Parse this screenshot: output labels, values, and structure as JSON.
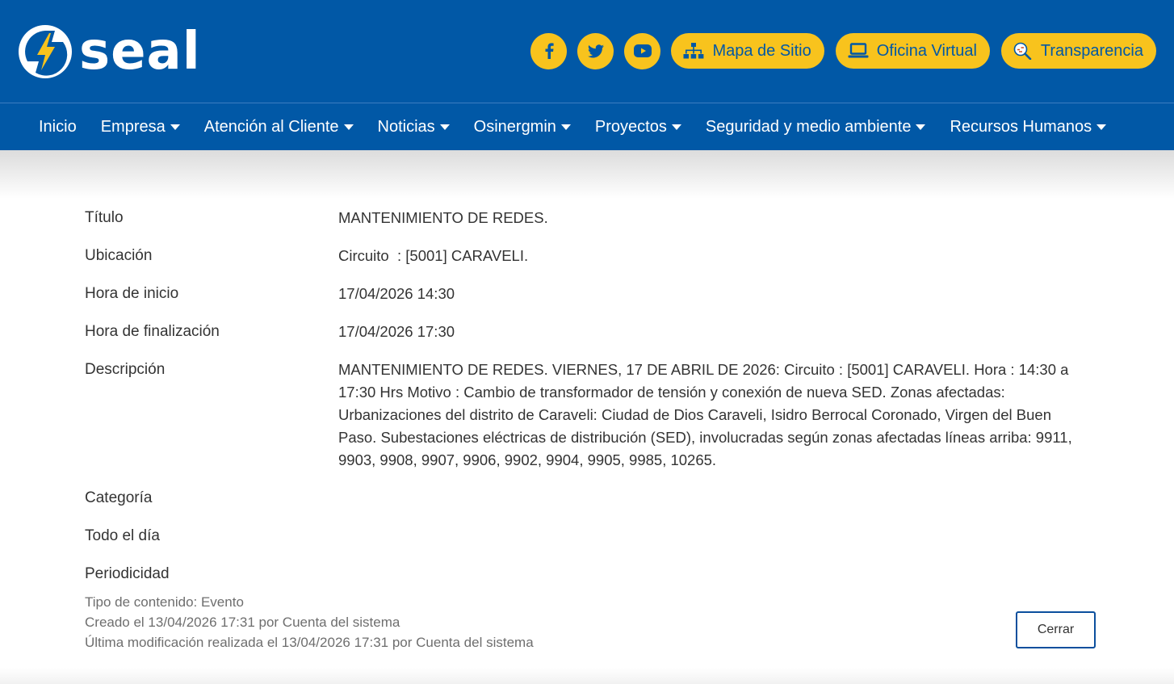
{
  "header": {
    "logo_text": "seal",
    "social": [
      {
        "icon": "facebook-icon"
      },
      {
        "icon": "twitter-icon"
      },
      {
        "icon": "youtube-icon"
      }
    ],
    "links": [
      {
        "label": "Mapa de Sitio",
        "icon": "sitemap-icon"
      },
      {
        "label": "Oficina Virtual",
        "icon": "laptop-icon"
      },
      {
        "label": "Transparencia",
        "icon": "transparency-icon"
      }
    ],
    "colors": {
      "primary": "#0158a6",
      "accent": "#f8c31d"
    }
  },
  "nav": {
    "items": [
      {
        "label": "Inicio",
        "dropdown": false
      },
      {
        "label": "Empresa",
        "dropdown": true
      },
      {
        "label": "Atención al Cliente",
        "dropdown": true
      },
      {
        "label": "Noticias",
        "dropdown": true
      },
      {
        "label": "Osinergmin",
        "dropdown": true
      },
      {
        "label": "Proyectos",
        "dropdown": true
      },
      {
        "label": "Seguridad y medio ambiente",
        "dropdown": true
      },
      {
        "label": "Recursos Humanos",
        "dropdown": true
      }
    ]
  },
  "details": {
    "rows": [
      {
        "label": "Título",
        "value": "MANTENIMIENTO DE REDES."
      },
      {
        "label": "Ubicación",
        "value": "Circuito  : [5001] CARAVELI."
      },
      {
        "label": "Hora de inicio",
        "value": "17/04/2026 14:30"
      },
      {
        "label": "Hora de finalización",
        "value": "17/04/2026 17:30"
      },
      {
        "label": "Descripción",
        "value": "MANTENIMIENTO DE REDES. VIERNES, 17 DE ABRIL DE 2026: Circuito : [5001] CARAVELI. Hora : 14:30 a 17:30 Hrs Motivo : Cambio de transformador de tensión y conexión de nueva SED. Zonas afectadas: Urbanizaciones del distrito de Caraveli: Ciudad de Dios Caraveli, Isidro Berrocal Coronado, Virgen del Buen Paso. Subestaciones eléctricas de distribución (SED), involucradas según zonas afectadas líneas arriba: 9911, 9903, 9908, 9907, 9906, 9902, 9904, 9905, 9985, 10265."
      },
      {
        "label": "Categoría",
        "value": ""
      },
      {
        "label": "Todo el día",
        "value": ""
      },
      {
        "label": "Periodicidad",
        "value": ""
      }
    ]
  },
  "meta": {
    "content_type": "Tipo de contenido: Evento",
    "created": "Creado el 13/04/2026 17:31 por Cuenta del sistema",
    "modified": "Última modificación realizada el 13/04/2026 17:31 por Cuenta del sistema"
  },
  "actions": {
    "close_label": "Cerrar"
  }
}
